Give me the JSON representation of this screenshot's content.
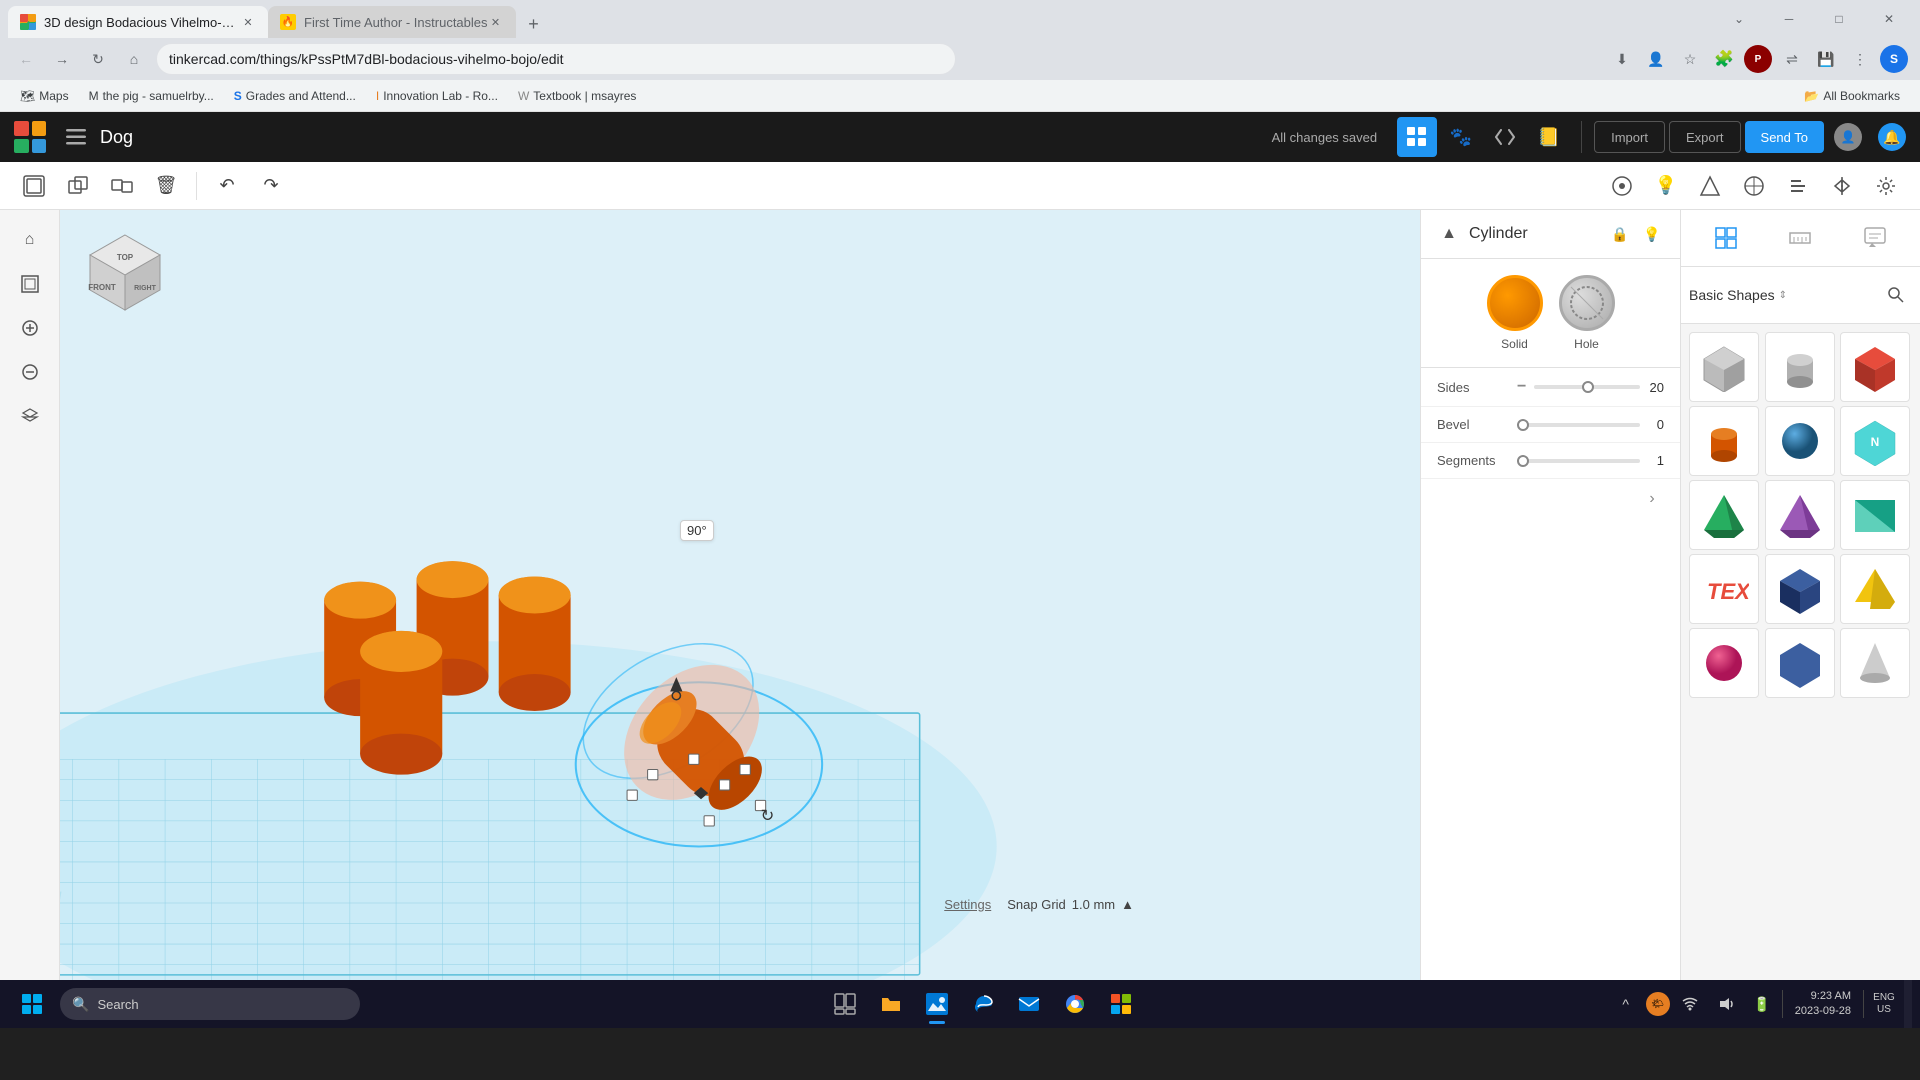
{
  "browser": {
    "tabs": [
      {
        "id": "tab1",
        "title": "3D design Bodacious Vihelmo-B...",
        "favicon_color": "#e67e22",
        "active": true
      },
      {
        "id": "tab2",
        "title": "First Time Author - Instructables",
        "favicon_color": "#ffcc00",
        "active": false
      }
    ],
    "address": "tinkercad.com/things/kPssPtM7dBl-bodacious-vihelmo-bojo/edit",
    "bookmarks": [
      {
        "icon": "🗺",
        "label": "Maps"
      },
      {
        "icon": "M",
        "label": "the pig - samuelrby..."
      },
      {
        "icon": "S",
        "label": "Grades and Attend..."
      },
      {
        "icon": "I",
        "label": "Innovation Lab - Ro..."
      },
      {
        "icon": "W",
        "label": "Textbook | msayres"
      }
    ],
    "all_bookmarks_label": "All Bookmarks"
  },
  "appbar": {
    "logo_colors": [
      "#e74c3c",
      "#f39c12",
      "#27ae60",
      "#3498db"
    ],
    "design_name": "Dog",
    "save_status": "All changes saved",
    "import_label": "Import",
    "export_label": "Export",
    "sendto_label": "Send To"
  },
  "toolbar": {
    "buttons": [
      {
        "name": "new-design",
        "icon": "⬜"
      },
      {
        "name": "group",
        "icon": "⧉"
      },
      {
        "name": "ungroup",
        "icon": "❑"
      },
      {
        "name": "delete",
        "icon": "🗑"
      },
      {
        "name": "undo",
        "icon": "↶"
      },
      {
        "name": "redo",
        "icon": "↷"
      }
    ]
  },
  "viewport": {
    "angle_label": "90°"
  },
  "properties": {
    "title": "Cylinder",
    "solid_label": "Solid",
    "hole_label": "Hole",
    "sides_label": "Sides",
    "sides_value": "20",
    "bevel_label": "Bevel",
    "bevel_value": "0",
    "segments_label": "Segments",
    "segments_value": "1"
  },
  "shapes_panel": {
    "category_label": "Basic Shapes",
    "shapes": [
      {
        "name": "box-grey",
        "color1": "#aaa",
        "color2": "#888",
        "type": "box"
      },
      {
        "name": "cylinder-grey",
        "color1": "#bbb",
        "color2": "#999",
        "type": "cylinder"
      },
      {
        "name": "box-red",
        "color1": "#e74c3c",
        "color2": "#c0392b",
        "type": "box"
      },
      {
        "name": "cylinder-orange",
        "color1": "#e67e22",
        "color2": "#d35400",
        "type": "cylinder"
      },
      {
        "name": "sphere-blue",
        "color1": "#3498db",
        "color2": "#2980b9",
        "type": "sphere"
      },
      {
        "name": "shape-teal",
        "color1": "#2cc",
        "color2": "#1aa",
        "type": "misc"
      },
      {
        "name": "pyramid-green",
        "color1": "#27ae60",
        "color2": "#229954",
        "type": "pyramid"
      },
      {
        "name": "pyramid-purple",
        "color1": "#9b59b6",
        "color2": "#8e44ad",
        "type": "pyramid"
      },
      {
        "name": "wedge-teal",
        "color1": "#1abc9c",
        "color2": "#16a085",
        "type": "wedge"
      },
      {
        "name": "text-red",
        "color1": "#e74c3c",
        "color2": "#c0392b",
        "type": "text"
      },
      {
        "name": "box-navy",
        "color1": "#2c3e7a",
        "color2": "#1a2560",
        "type": "box"
      },
      {
        "name": "prism-yellow",
        "color1": "#f1c40f",
        "color2": "#d4ac0d",
        "type": "prism"
      },
      {
        "name": "sphere-pink",
        "color1": "#e91e8c",
        "color2": "#c0176e",
        "type": "sphere"
      },
      {
        "name": "shape-blue2",
        "color1": "#3c5fa0",
        "color2": "#2a4580",
        "type": "misc"
      },
      {
        "name": "cone-grey",
        "color1": "#ccc",
        "color2": "#aaa",
        "type": "cone"
      }
    ]
  },
  "settings_bar": {
    "settings_label": "Settings",
    "snap_grid_label": "Snap Grid",
    "snap_grid_value": "1.0 mm"
  },
  "taskbar": {
    "search_placeholder": "Search",
    "system": {
      "time": "9:23 AM",
      "date": "2023-09-28",
      "locale": "ENG\nUS"
    }
  }
}
